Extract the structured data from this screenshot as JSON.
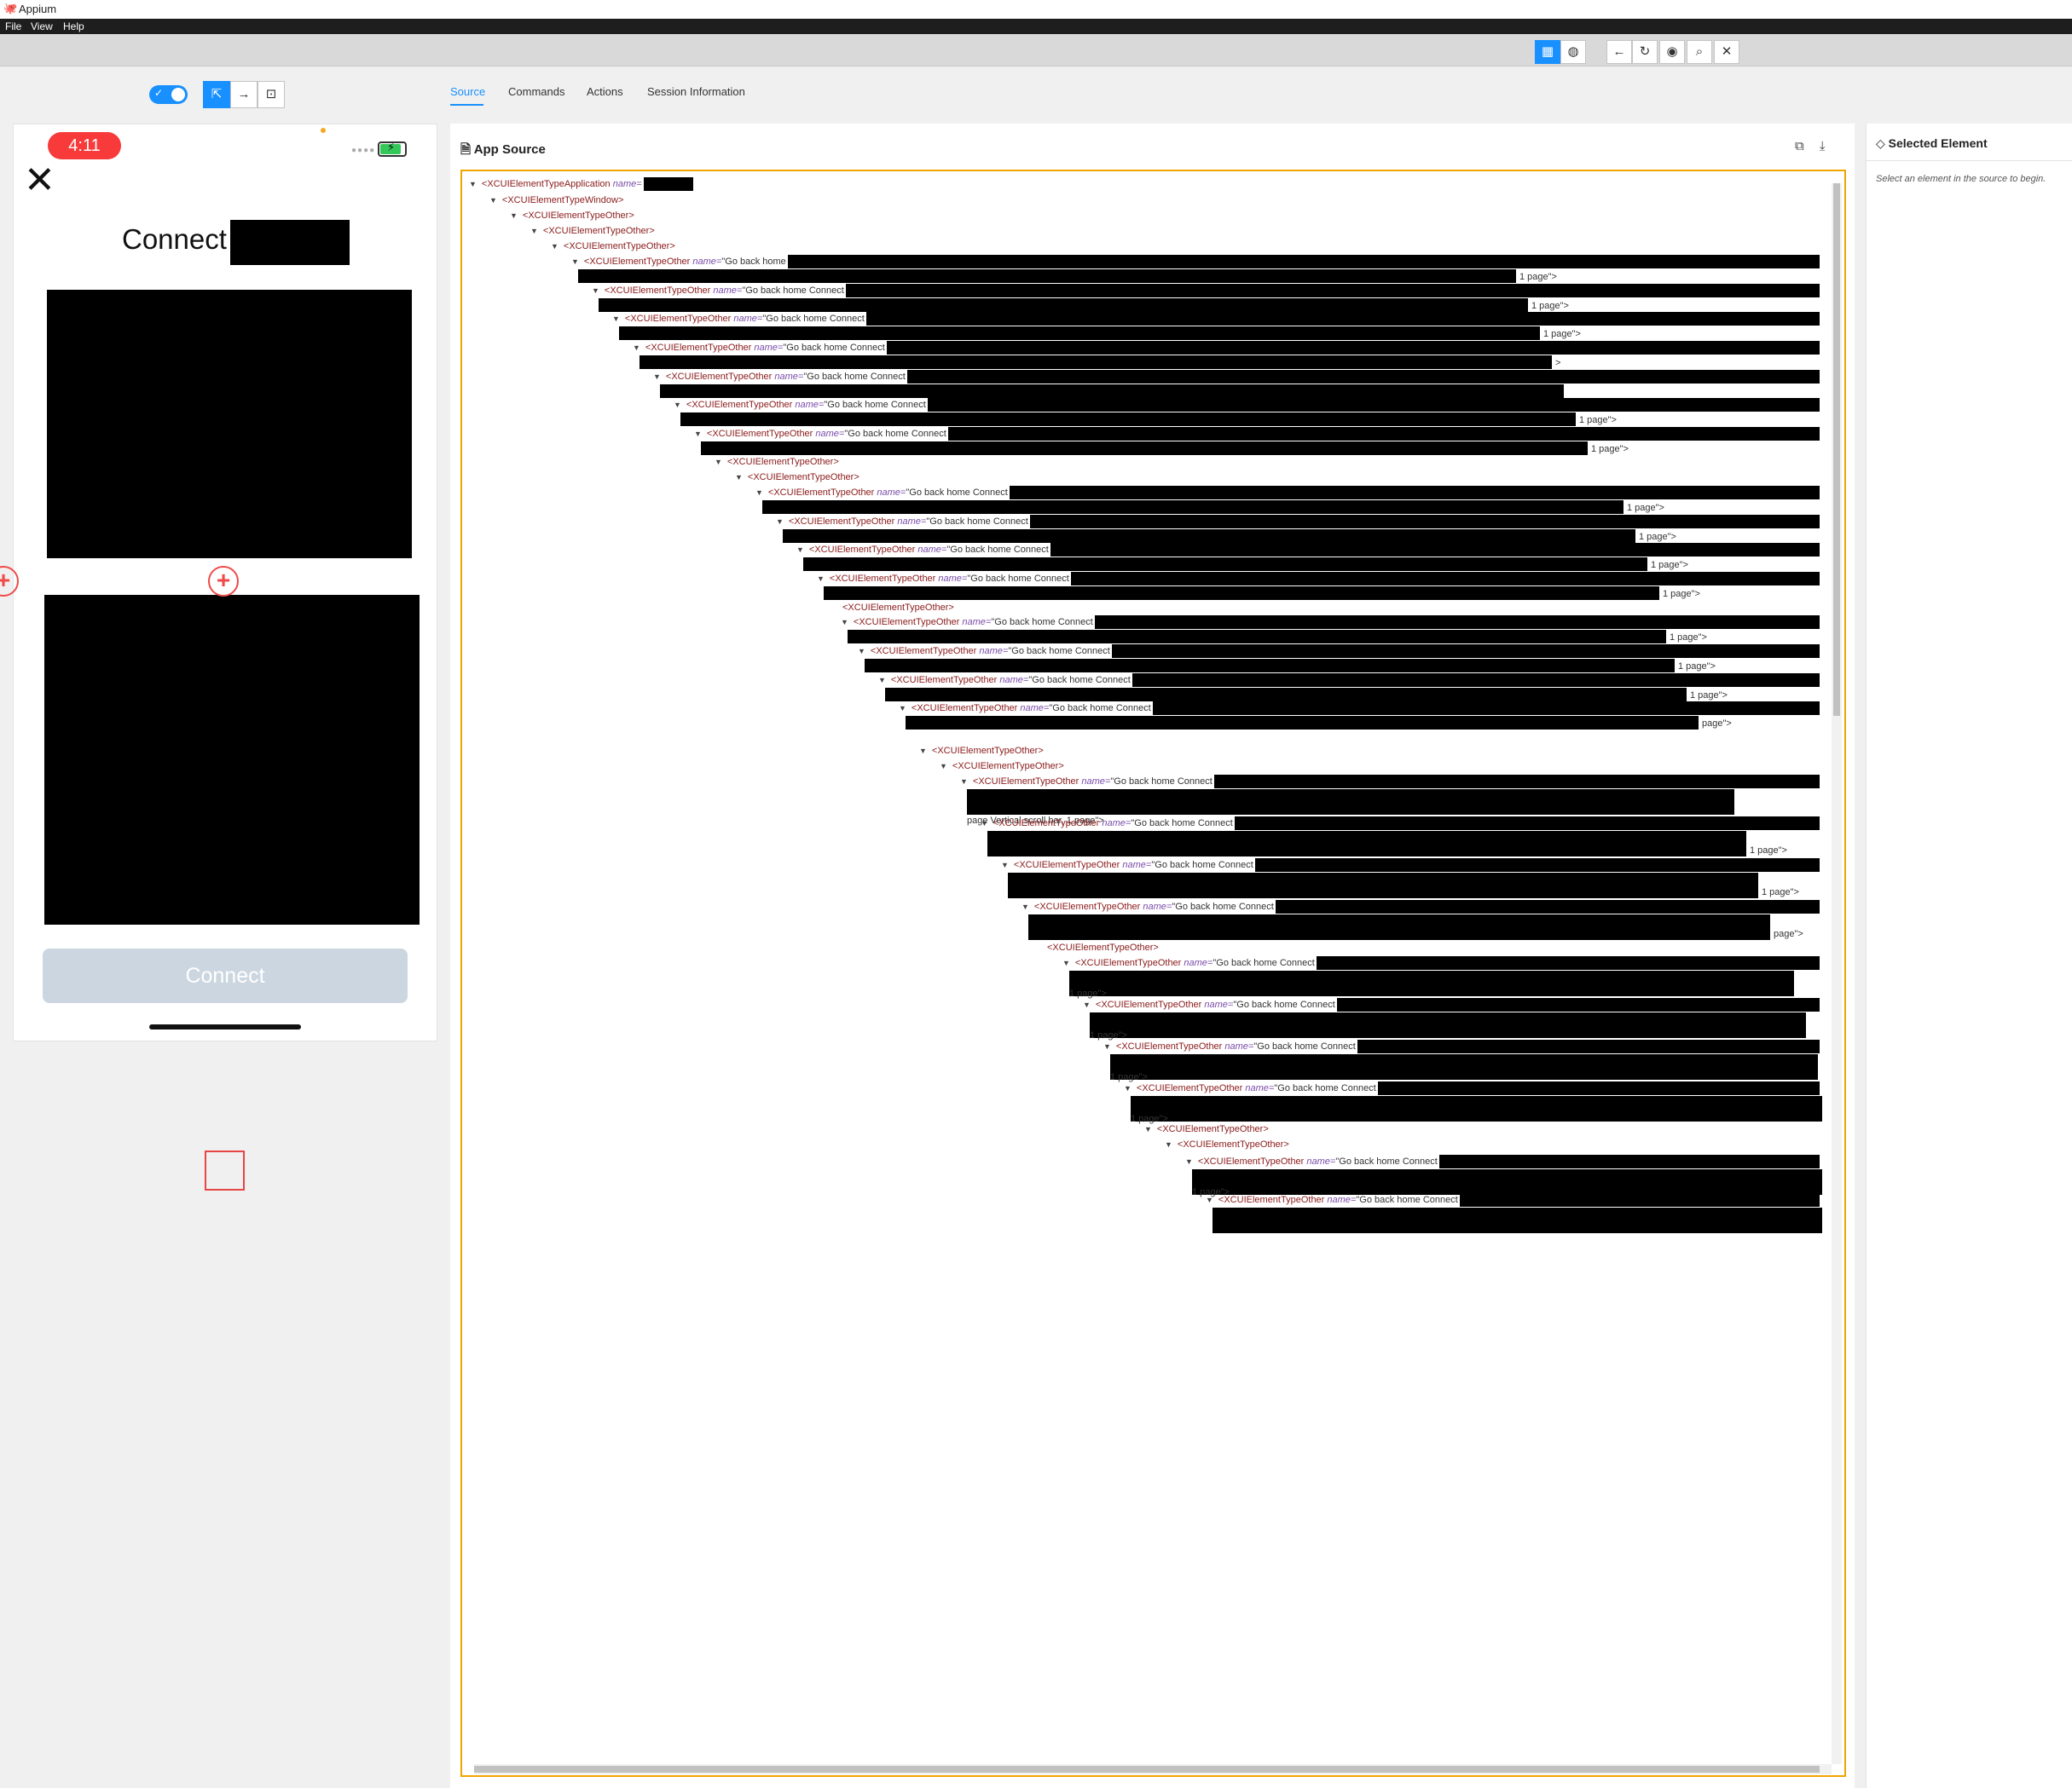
{
  "window": {
    "title": "Appium",
    "menu": [
      "File",
      "View",
      "Help"
    ]
  },
  "toolbar": {
    "icons": [
      "grid-icon",
      "globe-icon",
      "back-icon",
      "refresh-icon",
      "eye-icon",
      "search-icon",
      "close-icon"
    ]
  },
  "tabs": [
    {
      "label": "Source",
      "active": true
    },
    {
      "label": "Commands",
      "active": false
    },
    {
      "label": "Actions",
      "active": false
    },
    {
      "label": "Session Information",
      "active": false
    }
  ],
  "device": {
    "time": "4:11",
    "title": "Connect",
    "button": "Connect"
  },
  "source": {
    "header": "App Source",
    "attr": "name=",
    "lines": [
      {
        "i": 0,
        "tag": "<XCUIElementTypeApplication ",
        "attr": "name=",
        "val": ""
      },
      {
        "i": 1,
        "tag": "<XCUIElementTypeWindow>",
        "attr": "",
        "val": ""
      },
      {
        "i": 2,
        "tag": "<XCUIElementTypeOther>",
        "attr": "",
        "val": ""
      },
      {
        "i": 3,
        "tag": "<XCUIElementTypeOther>",
        "attr": "",
        "val": ""
      },
      {
        "i": 4,
        "tag": "<XCUIElementTypeOther>",
        "attr": "",
        "val": ""
      },
      {
        "i": 5,
        "tag": "<XCUIElementTypeOther ",
        "attr": "name=",
        "val": "\"Go back home"
      },
      {
        "i": 6,
        "tag": "<XCUIElementTypeOther ",
        "attr": "name=",
        "val": "\"Go back home Connect"
      },
      {
        "i": 7,
        "tag": "<XCUIElementTypeOther ",
        "attr": "name=",
        "val": "\"Go back home Connect"
      },
      {
        "i": 8,
        "tag": "<XCUIElementTypeOther ",
        "attr": "name=",
        "val": "\"Go back home Connect"
      },
      {
        "i": 9,
        "tag": "<XCUIElementTypeOther ",
        "attr": "name=",
        "val": "\"Go back home Connect"
      },
      {
        "i": 10,
        "tag": "<XCUIElementTypeOther ",
        "attr": "name=",
        "val": "\"Go back home Connect"
      },
      {
        "i": 11,
        "tag": "<XCUIElementTypeOther ",
        "attr": "name=",
        "val": "\"Go back home Connect"
      },
      {
        "i": 12,
        "tag": "<XCUIElementTypeOther>",
        "attr": "",
        "val": ""
      },
      {
        "i": 13,
        "tag": "<XCUIElementTypeOther>",
        "attr": "",
        "val": ""
      },
      {
        "i": 14,
        "tag": "<XCUIElementTypeOther ",
        "attr": "name=",
        "val": "\"Go back home Connect"
      },
      {
        "i": 15,
        "tag": "<XCUIElementTypeOther ",
        "attr": "name=",
        "val": "\"Go back home Connect"
      },
      {
        "i": 16,
        "tag": "<XCUIElementTypeOther ",
        "attr": "name=",
        "val": "\"Go back home Connect"
      },
      {
        "i": 17,
        "tag": "<XCUIElementTypeOther ",
        "attr": "name=",
        "val": "\"Go back home Connect"
      },
      {
        "i": 18,
        "tag": "<XCUIElementTypeOther>",
        "attr": "",
        "val": ""
      },
      {
        "i": 19,
        "tag": "<XCUIElementTypeOther ",
        "attr": "name=",
        "val": "\"Go back home Connect"
      },
      {
        "i": 20,
        "tag": "<XCUIElementTypeOther ",
        "attr": "name=",
        "val": "\"Go back home Connect"
      },
      {
        "i": 21,
        "tag": "<XCUIElementTypeOther ",
        "attr": "name=",
        "val": "\"Go back home Connect"
      },
      {
        "i": 22,
        "tag": "<XCUIElementTypeOther ",
        "attr": "name=",
        "val": "\"Go back home Connect"
      },
      {
        "i": 23,
        "tag": "<XCUIElementTypeOther>",
        "attr": "",
        "val": ""
      },
      {
        "i": 24,
        "tag": "<XCUIElementTypeOther>",
        "attr": "",
        "val": ""
      },
      {
        "i": 25,
        "tag": "<XCUIElementTypeOther ",
        "attr": "name=",
        "val": "\"Go back home Connect"
      },
      {
        "i": 26,
        "tag": "<XCUIElementTypeOther ",
        "attr": "name=",
        "val": "\"Go back home Connect"
      },
      {
        "i": 27,
        "tag": "<XCUIElementTypeOther ",
        "attr": "name=",
        "val": "\"Go back home Connect"
      },
      {
        "i": 28,
        "tag": "<XCUIElementTypeOther ",
        "attr": "name=",
        "val": "\"Go back home Connect"
      },
      {
        "i": 29,
        "tag": "<XCUIElementTypeOther>",
        "attr": "",
        "val": ""
      },
      {
        "i": 30,
        "tag": "<XCUIElementTypeOther ",
        "attr": "name=",
        "val": "\"Go back home Connect"
      },
      {
        "i": 31,
        "tag": "<XCUIElementTypeOther ",
        "attr": "name=",
        "val": "\"Go back home Connect"
      },
      {
        "i": 32,
        "tag": "<XCUIElementTypeOther ",
        "attr": "name=",
        "val": "\"Go back home Connect"
      },
      {
        "i": 33,
        "tag": "<XCUIElementTypeOther ",
        "attr": "name=",
        "val": "\"Go back home Connect"
      },
      {
        "i": 34,
        "tag": "<XCUIElementTypeOther>",
        "attr": "",
        "val": ""
      },
      {
        "i": 35,
        "tag": "<XCUIElementTypeOther>",
        "attr": "",
        "val": ""
      },
      {
        "i": 36,
        "tag": "<XCUIElementTypeOther ",
        "attr": "name=",
        "val": "\"Go back home Connect"
      },
      {
        "i": 37,
        "tag": "<XCUIElementTypeOther ",
        "attr": "name=",
        "val": "\"Go back home Connect"
      }
    ],
    "suffix": "1 page\">",
    "suffix_short": "page\">",
    "suffix_caret": ">",
    "suffix_one": "1",
    "scroll_text": "page Vertical scroll bar, 1 page\">"
  },
  "selected": {
    "header": "Selected Element",
    "hint": "Select an element in the source to begin."
  }
}
